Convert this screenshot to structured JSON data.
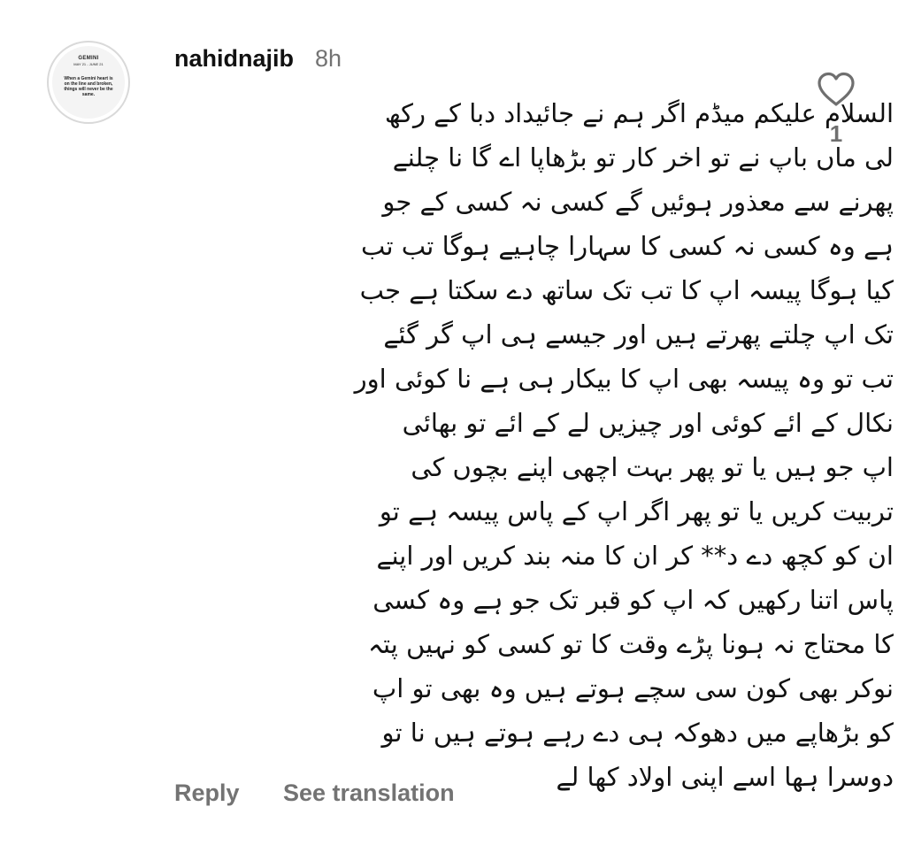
{
  "comment": {
    "username": "nahidnajib",
    "timestamp": "8h",
    "like_count": "1",
    "lines": [
      "السلام علیکم میڈم اگر ہم نے جائیداد دبا کے رکھ",
      "لی ماں باپ نے تو اخر کار تو  بڑھاپا اے گا نا چلنے",
      "پھرنے سے معذور ہوئیں گے کسی نہ کسی کے جو",
      "ہے وہ کسی نہ کسی کا سہارا چاہیے ہوگا تب تب",
      "کیا ہوگا پیسہ اپ کا تب تک ساتھ دے سکتا ہے جب",
      "تک اپ چلتے پھرتے ہیں اور جیسے ہی اپ گر گئے",
      "تب تو وہ پیسہ بھی اپ کا بیکار ہی ہے نا کوئی اور",
      "نکال کے ائے کوئی اور چیزیں لے کے ائے تو بھائی",
      "اپ جو ہیں یا تو پھر بہت اچھی اپنے بچوں کی",
      "تربیت کریں یا تو پھر اگر اپ کے پاس پیسہ ہے تو",
      "ان کو کچھ دے د** کر ان کا منہ بند کریں اور اپنے",
      "پاس اتنا رکھیں کہ اپ کو قبر تک جو ہے وہ کسی",
      "کا محتاج نہ ہونا پڑے وقت کا تو کسی کو نہیں پتہ",
      "نوکر بھی کون سی سچے ہوتے ہیں وہ بھی تو اپ",
      "کو بڑھاپے میں دھوکہ ہی دے رہے ہوتے ہیں نا تو",
      "دوسرا ہھا اسے اپنی اولاد کھا لے"
    ],
    "avatar": {
      "title": "GEMINI",
      "dates": "MAY 21 - JUNE 21",
      "text": "When a Gemini heart is on the line and broken, things will never be the same."
    },
    "actions": {
      "reply_label": "Reply",
      "see_translation_label": "See translation"
    },
    "colors": {
      "text": "#111111",
      "muted": "#737373",
      "background": "#ffffff"
    },
    "icons": {
      "like": "heart-outline-icon"
    }
  }
}
